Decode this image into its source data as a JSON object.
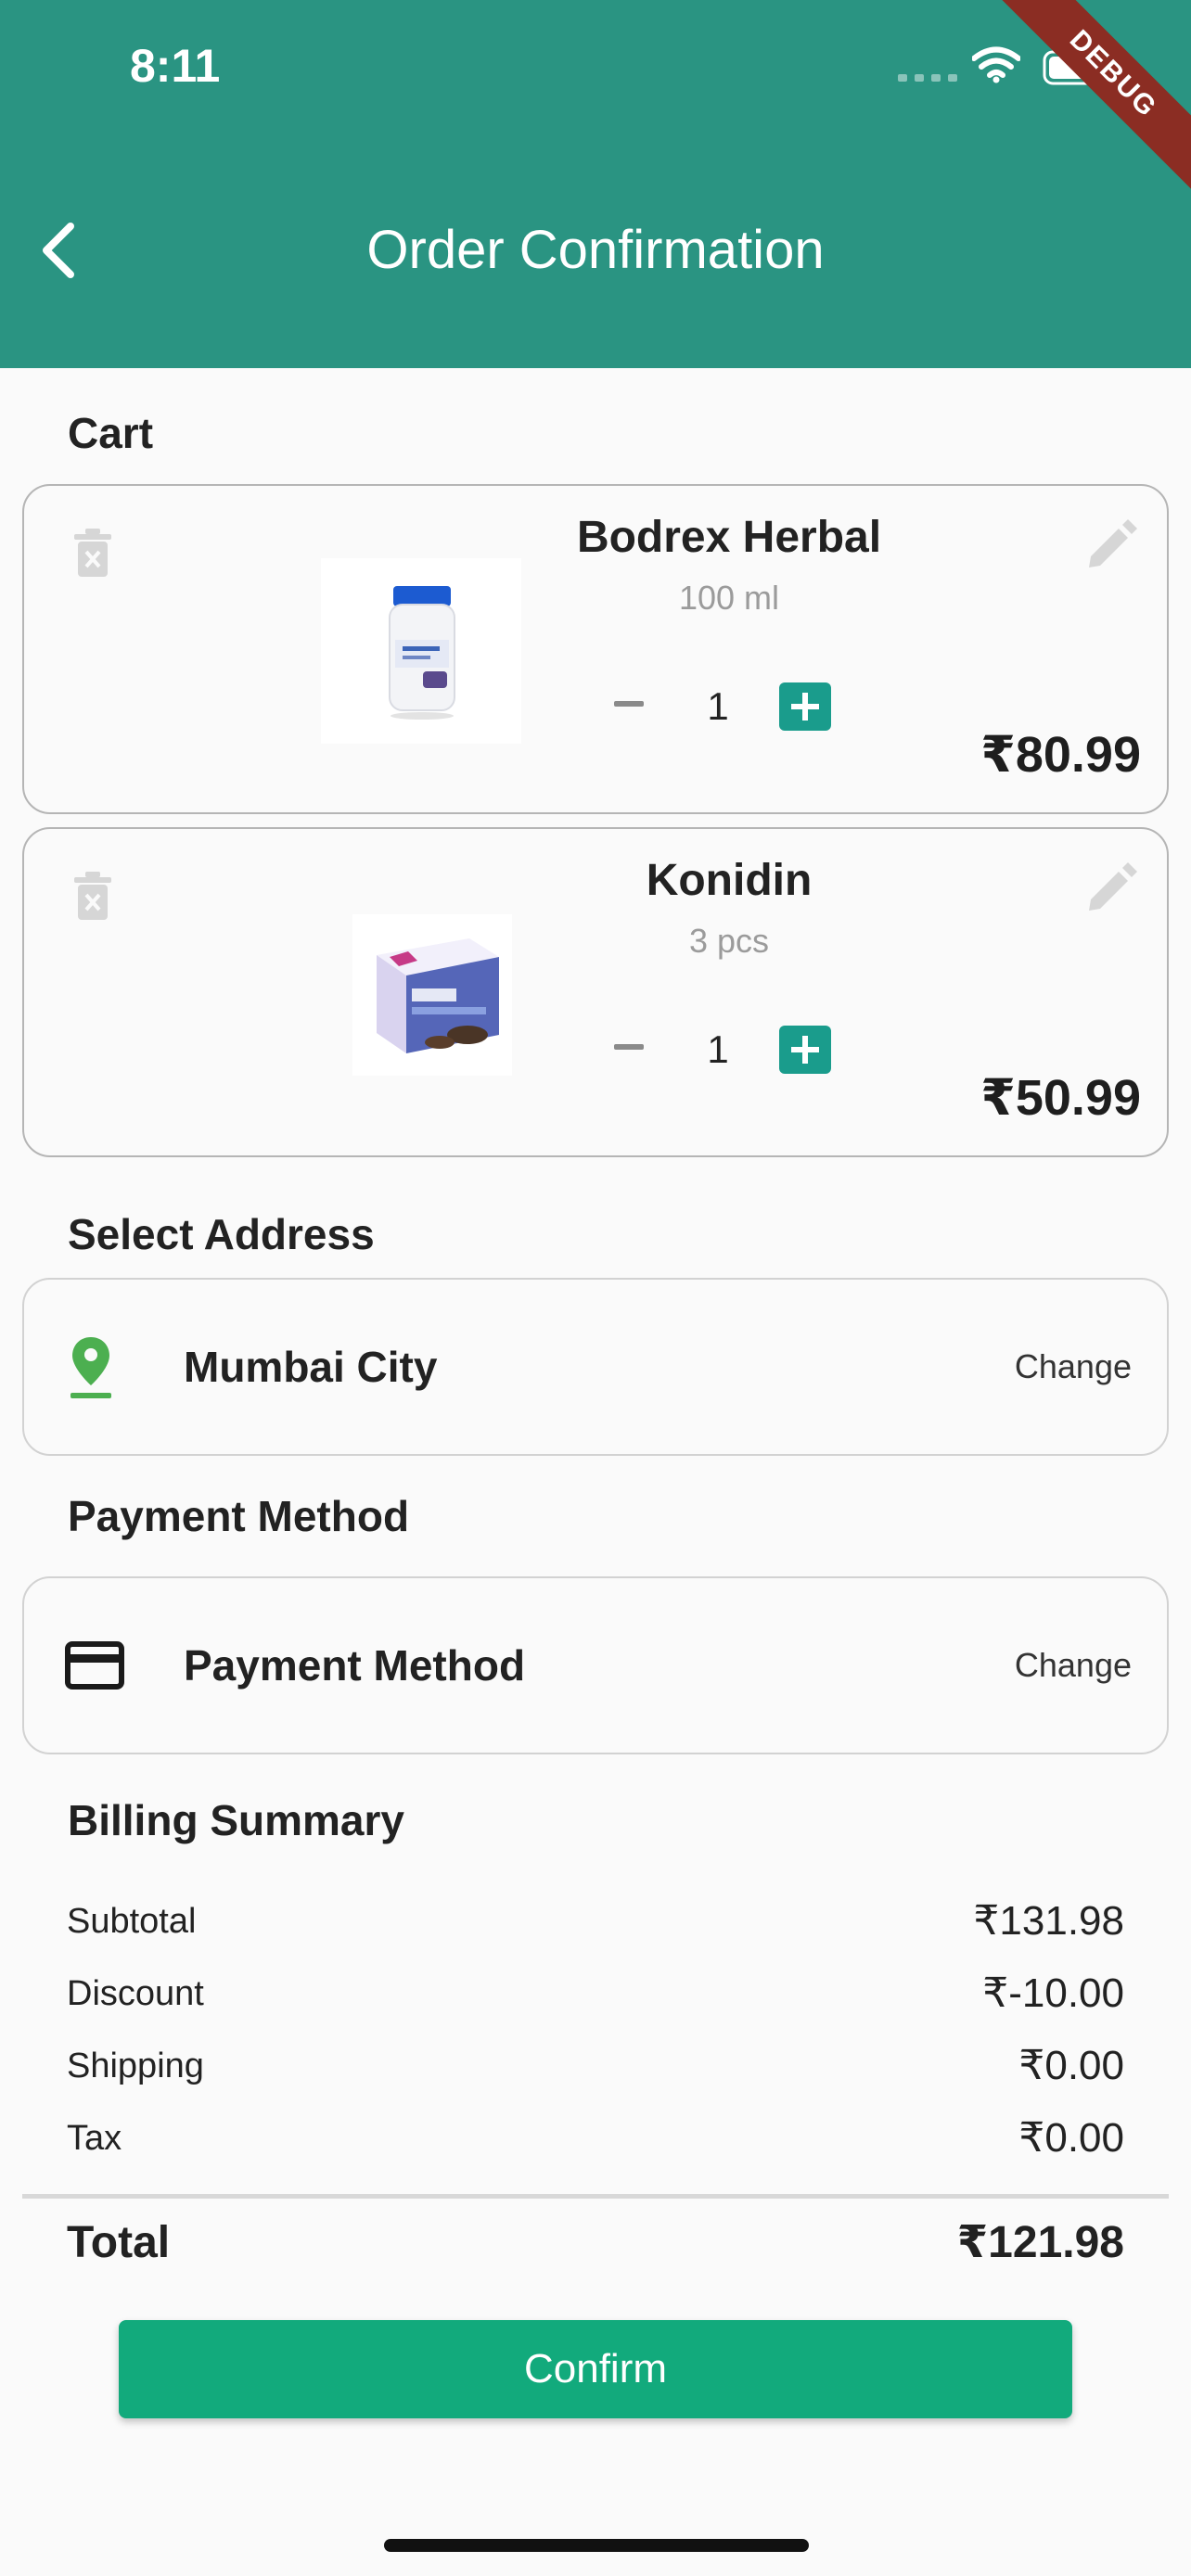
{
  "status_bar": {
    "time": "8:11",
    "icons": [
      "signal-dots-icon",
      "wifi-icon",
      "battery-icon"
    ]
  },
  "debug_banner": "DEBUG",
  "header": {
    "title": "Order Confirmation",
    "back_icon": "chevron-left-icon"
  },
  "cart": {
    "title": "Cart",
    "items": [
      {
        "name": "Bodrex Herbal",
        "size": "100 ml",
        "quantity": "1",
        "price": "₹80.99",
        "image": "supplement-bottle"
      },
      {
        "name": "Konidin",
        "size": "3 pcs",
        "quantity": "1",
        "price": "₹50.99",
        "image": "medicine-box"
      }
    ]
  },
  "address": {
    "title": "Select Address",
    "value": "Mumbai City",
    "change_label": "Change",
    "icon": "location-pin-icon"
  },
  "payment": {
    "title": "Payment Method",
    "value": "Payment Method",
    "change_label": "Change",
    "icon": "credit-card-icon"
  },
  "billing": {
    "title": "Billing Summary",
    "rows": [
      {
        "label": "Subtotal",
        "value": "₹131.98"
      },
      {
        "label": "Discount",
        "value": "₹-10.00"
      },
      {
        "label": "Shipping",
        "value": "₹0.00"
      },
      {
        "label": "Tax",
        "value": "₹0.00"
      }
    ],
    "total_label": "Total",
    "total_value": "₹121.98"
  },
  "confirm_label": "Confirm",
  "colors": {
    "header": "#2a9482",
    "accent": "#1a9c8c",
    "confirm": "#12aa7c",
    "location": "#4caf50",
    "debug": "#8b2d23"
  }
}
